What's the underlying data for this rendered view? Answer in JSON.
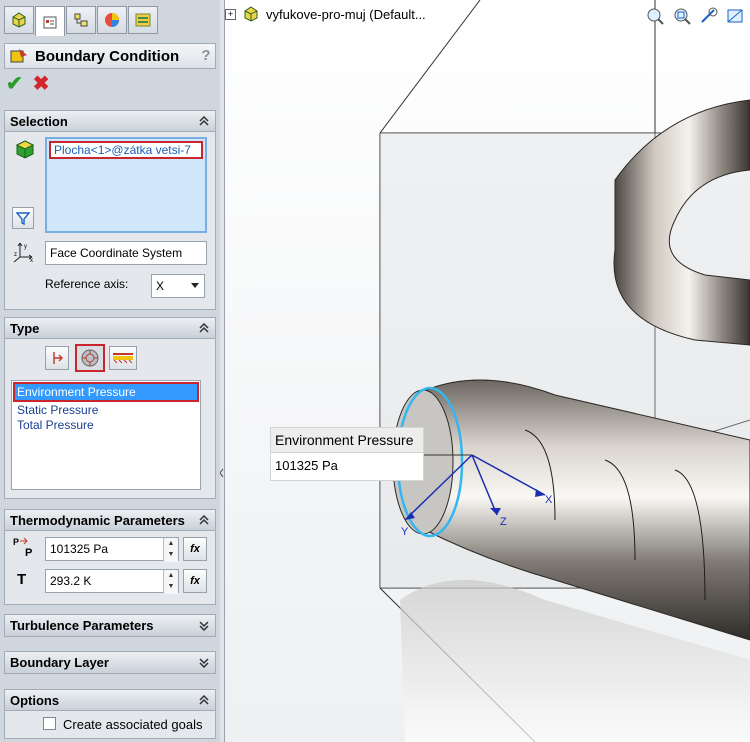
{
  "panel": {
    "title": "Boundary Condition",
    "help": "?",
    "ok_symbol": "✔",
    "cancel_symbol": "✖"
  },
  "selection": {
    "header": "Selection",
    "item": "Plocha<1>@zátka vetsi-7",
    "coord_system": "Face Coordinate System",
    "ref_axis_label": "Reference axis:",
    "ref_axis_value": "X"
  },
  "type": {
    "header": "Type",
    "items": [
      "Environment Pressure",
      "Static Pressure",
      "Total Pressure"
    ]
  },
  "thermo": {
    "header": "Thermodynamic Parameters",
    "pressure_value": "101325 Pa",
    "temp_label": "T",
    "temp_value": "293.2 K",
    "fx": "fx"
  },
  "turbulence": {
    "header": "Turbulence Parameters"
  },
  "boundary_layer": {
    "header": "Boundary Layer"
  },
  "options": {
    "header": "Options",
    "create_goals": "Create associated goals"
  },
  "viewport": {
    "tree_label": "vyfukove-pro-muj  (Default...",
    "callout_title": "Environment Pressure",
    "callout_value": "101325 Pa",
    "axis_x": "X",
    "axis_y": "Y",
    "axis_z": "Z"
  },
  "colors": {
    "accent": "#3399ff",
    "highlight_border": "#c8262c",
    "panel_bg": "#cfd6de"
  }
}
